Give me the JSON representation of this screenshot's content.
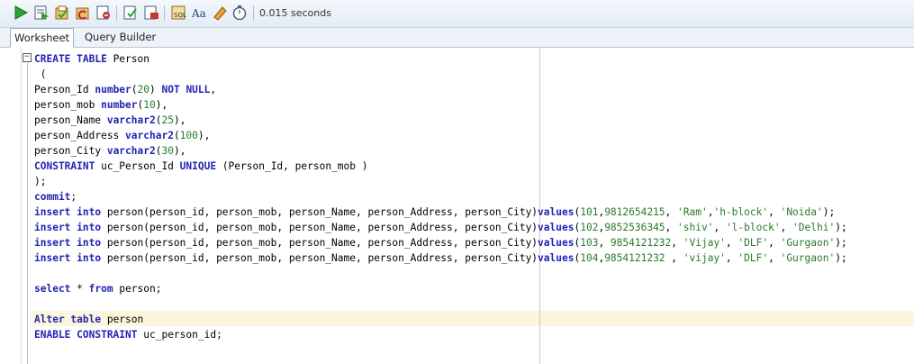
{
  "toolbar": {
    "buttons": [
      "run-statement-icon",
      "run-script-icon",
      "commit-icon",
      "rollback-icon",
      "cancel-icon",
      "sql-tuning-icon",
      "explain-plan-icon",
      "autotrace-icon",
      "sql-history-icon",
      "format-case-icon",
      "eraser-icon",
      "timer-icon"
    ],
    "timing": "0.015 seconds"
  },
  "tabs": [
    {
      "label": "Worksheet",
      "active": true
    },
    {
      "label": "Query Builder",
      "active": false
    }
  ],
  "code_lines": [
    [
      {
        "t": "CREATE TABLE",
        "c": "kw"
      },
      {
        "t": " Person",
        "c": "plain"
      }
    ],
    [
      {
        "t": " (",
        "c": "plain"
      }
    ],
    [
      {
        "t": "Person_Id ",
        "c": "plain"
      },
      {
        "t": "number",
        "c": "kw"
      },
      {
        "t": "(",
        "c": "plain"
      },
      {
        "t": "20",
        "c": "num"
      },
      {
        "t": ") ",
        "c": "plain"
      },
      {
        "t": "NOT NULL",
        "c": "kw"
      },
      {
        "t": ",",
        "c": "plain"
      }
    ],
    [
      {
        "t": "person_mob ",
        "c": "plain"
      },
      {
        "t": "number",
        "c": "kw"
      },
      {
        "t": "(",
        "c": "plain"
      },
      {
        "t": "10",
        "c": "num"
      },
      {
        "t": "),",
        "c": "plain"
      }
    ],
    [
      {
        "t": "person_Name ",
        "c": "plain"
      },
      {
        "t": "varchar2",
        "c": "kw"
      },
      {
        "t": "(",
        "c": "plain"
      },
      {
        "t": "25",
        "c": "num"
      },
      {
        "t": "),",
        "c": "plain"
      }
    ],
    [
      {
        "t": "person_Address ",
        "c": "plain"
      },
      {
        "t": "varchar2",
        "c": "kw"
      },
      {
        "t": "(",
        "c": "plain"
      },
      {
        "t": "100",
        "c": "num"
      },
      {
        "t": "),",
        "c": "plain"
      }
    ],
    [
      {
        "t": "person_City ",
        "c": "plain"
      },
      {
        "t": "varchar2",
        "c": "kw"
      },
      {
        "t": "(",
        "c": "plain"
      },
      {
        "t": "30",
        "c": "num"
      },
      {
        "t": "),",
        "c": "plain"
      }
    ],
    [
      {
        "t": "CONSTRAINT",
        "c": "kw"
      },
      {
        "t": " uc_Person_Id ",
        "c": "plain"
      },
      {
        "t": "UNIQUE",
        "c": "kw"
      },
      {
        "t": " (Person_Id, person_mob )",
        "c": "plain"
      }
    ],
    [
      {
        "t": ");",
        "c": "plain"
      }
    ],
    [
      {
        "t": "commit",
        "c": "kw"
      },
      {
        "t": ";",
        "c": "plain"
      }
    ],
    [
      {
        "t": "insert into",
        "c": "kw"
      },
      {
        "t": " person(person_id, person_mob, person_Name, person_Address, person_City)",
        "c": "plain"
      },
      {
        "t": "values",
        "c": "kw"
      },
      {
        "t": "(",
        "c": "plain"
      },
      {
        "t": "101",
        "c": "num"
      },
      {
        "t": ",",
        "c": "plain"
      },
      {
        "t": "9812654215",
        "c": "num"
      },
      {
        "t": ", ",
        "c": "plain"
      },
      {
        "t": "'Ram'",
        "c": "str"
      },
      {
        "t": ",",
        "c": "plain"
      },
      {
        "t": "'h-block'",
        "c": "str"
      },
      {
        "t": ", ",
        "c": "plain"
      },
      {
        "t": "'Noida'",
        "c": "str"
      },
      {
        "t": ");",
        "c": "plain"
      }
    ],
    [
      {
        "t": "insert into",
        "c": "kw"
      },
      {
        "t": " person(person_id, person_mob, person_Name, person_Address, person_City)",
        "c": "plain"
      },
      {
        "t": "values",
        "c": "kw"
      },
      {
        "t": "(",
        "c": "plain"
      },
      {
        "t": "102",
        "c": "num"
      },
      {
        "t": ",",
        "c": "plain"
      },
      {
        "t": "9852536345",
        "c": "num"
      },
      {
        "t": ", ",
        "c": "plain"
      },
      {
        "t": "'shiv'",
        "c": "str"
      },
      {
        "t": ", ",
        "c": "plain"
      },
      {
        "t": "'l-block'",
        "c": "str"
      },
      {
        "t": ", ",
        "c": "plain"
      },
      {
        "t": "'Delhi'",
        "c": "str"
      },
      {
        "t": ");",
        "c": "plain"
      }
    ],
    [
      {
        "t": "insert into",
        "c": "kw"
      },
      {
        "t": " person(person_id, person_mob, person_Name, person_Address, person_City)",
        "c": "plain"
      },
      {
        "t": "values",
        "c": "kw"
      },
      {
        "t": "(",
        "c": "plain"
      },
      {
        "t": "103",
        "c": "num"
      },
      {
        "t": ", ",
        "c": "plain"
      },
      {
        "t": "9854121232",
        "c": "num"
      },
      {
        "t": ", ",
        "c": "plain"
      },
      {
        "t": "'Vijay'",
        "c": "str"
      },
      {
        "t": ", ",
        "c": "plain"
      },
      {
        "t": "'DLF'",
        "c": "str"
      },
      {
        "t": ", ",
        "c": "plain"
      },
      {
        "t": "'Gurgaon'",
        "c": "str"
      },
      {
        "t": ");",
        "c": "plain"
      }
    ],
    [
      {
        "t": "insert into",
        "c": "kw"
      },
      {
        "t": " person(person_id, person_mob, person_Name, person_Address, person_City)",
        "c": "plain"
      },
      {
        "t": "values",
        "c": "kw"
      },
      {
        "t": "(",
        "c": "plain"
      },
      {
        "t": "104",
        "c": "num"
      },
      {
        "t": ",",
        "c": "plain"
      },
      {
        "t": "9854121232",
        "c": "num"
      },
      {
        "t": " , ",
        "c": "plain"
      },
      {
        "t": "'vijay'",
        "c": "str"
      },
      {
        "t": ", ",
        "c": "plain"
      },
      {
        "t": "'DLF'",
        "c": "str"
      },
      {
        "t": ", ",
        "c": "plain"
      },
      {
        "t": "'Gurgaon'",
        "c": "str"
      },
      {
        "t": ");",
        "c": "plain"
      }
    ],
    [
      {
        "t": "",
        "c": "plain"
      }
    ],
    [
      {
        "t": "select",
        "c": "kw"
      },
      {
        "t": " * ",
        "c": "plain"
      },
      {
        "t": "from",
        "c": "kw"
      },
      {
        "t": " person;",
        "c": "plain"
      }
    ],
    [
      {
        "t": "",
        "c": "plain"
      }
    ],
    [
      {
        "t": "Alter table",
        "c": "kw"
      },
      {
        "t": " person",
        "c": "plain"
      }
    ],
    [
      {
        "t": "ENABLE CONSTRAINT",
        "c": "kw"
      },
      {
        "t": " uc_person_id;",
        "c": "plain"
      }
    ]
  ],
  "colors": {
    "keyword": "#2323b4",
    "number": "#2a7a2a",
    "current_line": "#fbf7dc"
  }
}
